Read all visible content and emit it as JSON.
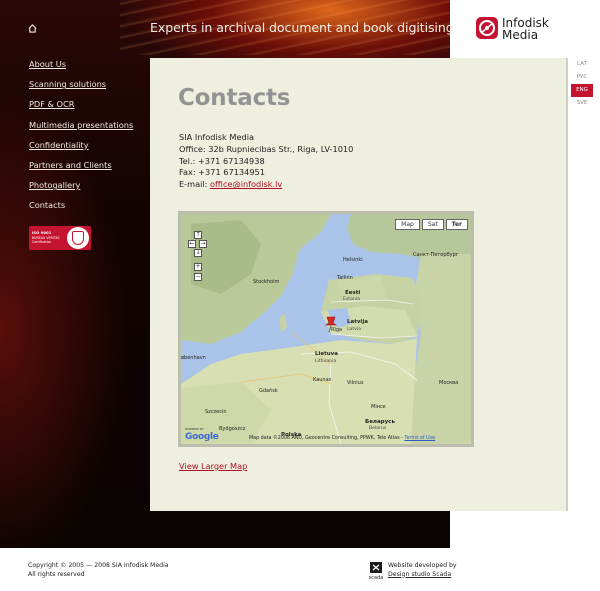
{
  "header": {
    "tagline": "Experts in archival document and book digitising",
    "logo": {
      "line1": "Infodisk",
      "line2": "Media"
    }
  },
  "languages": [
    {
      "label": "LAT",
      "active": false
    },
    {
      "label": "PУС",
      "active": false
    },
    {
      "label": "ENG",
      "active": true
    },
    {
      "label": "SVE",
      "active": false
    }
  ],
  "nav": {
    "items": [
      "About Us",
      "Scanning solutions",
      "PDF & OCR",
      "Multimedia presentations",
      "Confidentiality",
      "Partners and Clients",
      "Photogallery",
      "Contacts"
    ],
    "current": "Contacts"
  },
  "certificate": {
    "iso": "ISO 9001",
    "body": "BUREAU VERITAS Certification"
  },
  "content": {
    "title": "Contacts",
    "company": "SIA Infodisk Media",
    "office": "Office: 32b Rupniecibas Str., Riga, LV-1010",
    "tel": "Tel.: +371 67134938",
    "fax": "Fax: +371 67134951",
    "email_label": "E-mail:",
    "email": "office@infodisk.lv",
    "larger_map": "View Larger Map"
  },
  "map": {
    "type_buttons": [
      "Map",
      "Sat",
      "Ter"
    ],
    "active_type": "Ter",
    "controls": [
      "↑",
      "←",
      "→",
      "↓",
      "+",
      "−"
    ],
    "places": {
      "helsinki": "Helsinki",
      "spb": "Санкт-Петербург",
      "stockholm": "Stockholm",
      "tallinn": "Tallinn",
      "eesti": "Eesti",
      "estonia": "Estonia",
      "latvija": "Latvija",
      "riga": "Rīga",
      "latvia": "Latvia",
      "lietuva": "Lietuva",
      "lithuania": "Lithuania",
      "kaunas": "Kaunas",
      "vilnius": "Vilnius",
      "kobenhavn": "øbenhavn",
      "gdansk": "Gdańsk",
      "minsk": "Мінск",
      "belarus": "Беларусь",
      "belarus_en": "Belarus",
      "szczecin": "Szczecin",
      "bydgoszcz": "Bydgoszcz",
      "polska": "Polska",
      "moskva": "Москва"
    },
    "powered_by": "POWERED BY",
    "google": "Google",
    "credit": "Map data ©2008 AND, Geocentre Consulting, PPWK, Tele Atlas -",
    "terms": "Terms of Use"
  },
  "footer": {
    "copyright_line1": "Copyright © 2005 — 2008 SIA Infodisk Media",
    "copyright_line2": "All rights reserved",
    "dev_line1": "Website developed by",
    "dev_link": "Design studio Scada",
    "scada_label": "scada"
  },
  "colors": {
    "brand_red": "#c4142f",
    "panel": "#efefe0",
    "link": "#b01024"
  }
}
